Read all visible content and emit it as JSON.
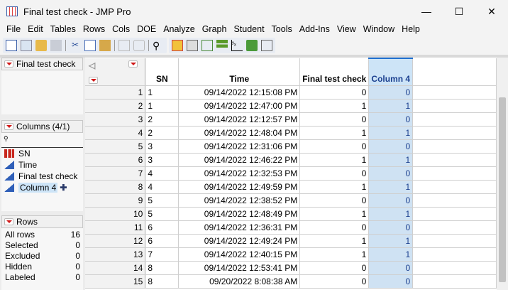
{
  "window": {
    "title": "Final test check - JMP Pro",
    "minimize": "—",
    "maximize": "☐",
    "close": "✕"
  },
  "menu": [
    "File",
    "Edit",
    "Tables",
    "Rows",
    "Cols",
    "DOE",
    "Analyze",
    "Graph",
    "Student",
    "Tools",
    "Add-Ins",
    "View",
    "Window",
    "Help"
  ],
  "table_panel": {
    "title": "Final test check"
  },
  "columns_panel": {
    "title": "Columns (4/1)",
    "search_icon": "🔍",
    "items": [
      {
        "name": "SN",
        "type": "nominal"
      },
      {
        "name": "Time",
        "type": "continuous"
      },
      {
        "name": "Final test check",
        "type": "continuous"
      },
      {
        "name": "Column 4",
        "type": "continuous",
        "selected": true
      }
    ]
  },
  "rows_panel": {
    "title": "Rows",
    "stats": [
      {
        "label": "All rows",
        "value": "16"
      },
      {
        "label": "Selected",
        "value": "0"
      },
      {
        "label": "Excluded",
        "value": "0"
      },
      {
        "label": "Hidden",
        "value": "0"
      },
      {
        "label": "Labeled",
        "value": "0"
      }
    ]
  },
  "grid": {
    "headers": [
      "SN",
      "Time",
      "Final test check",
      "Column 4"
    ],
    "rows": [
      [
        "1",
        "1",
        "09/14/2022 12:15:08 PM",
        "0",
        "0"
      ],
      [
        "2",
        "1",
        "09/14/2022 12:47:00 PM",
        "1",
        "1"
      ],
      [
        "3",
        "2",
        "09/14/2022 12:12:57 PM",
        "0",
        "0"
      ],
      [
        "4",
        "2",
        "09/14/2022 12:48:04 PM",
        "1",
        "1"
      ],
      [
        "5",
        "3",
        "09/14/2022 12:31:06 PM",
        "0",
        "0"
      ],
      [
        "6",
        "3",
        "09/14/2022 12:46:22 PM",
        "1",
        "1"
      ],
      [
        "7",
        "4",
        "09/14/2022 12:32:53 PM",
        "0",
        "0"
      ],
      [
        "8",
        "4",
        "09/14/2022 12:49:59 PM",
        "1",
        "1"
      ],
      [
        "9",
        "5",
        "09/14/2022 12:38:52 PM",
        "0",
        "0"
      ],
      [
        "10",
        "5",
        "09/14/2022 12:48:49 PM",
        "1",
        "1"
      ],
      [
        "11",
        "6",
        "09/14/2022 12:36:31 PM",
        "0",
        "0"
      ],
      [
        "12",
        "6",
        "09/14/2022 12:49:24 PM",
        "1",
        "1"
      ],
      [
        "13",
        "7",
        "09/14/2022 12:40:15 PM",
        "1",
        "1"
      ],
      [
        "14",
        "8",
        "09/14/2022 12:53:41 PM",
        "0",
        "0"
      ],
      [
        "15",
        "8",
        "09/20/2022 8:08:38 AM",
        "0",
        "0"
      ]
    ]
  }
}
